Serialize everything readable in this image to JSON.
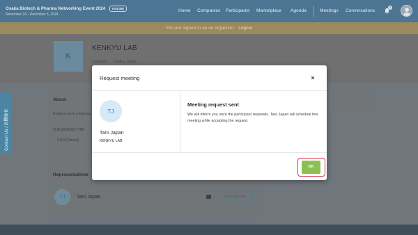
{
  "header": {
    "event_title": "Osaka Biotech & Pharma Networking Event 2024",
    "event_badge": "ONLINE",
    "event_dates": "November 24 - December 6, 2024",
    "nav": [
      "Home",
      "Companies",
      "Participants",
      "Marketplace",
      "Agenda",
      "Meetings",
      "Conversations"
    ],
    "notification_count": "1"
  },
  "banner": {
    "text": "You are signed in as an organizer.",
    "logout": "Logout"
  },
  "company": {
    "logo_letter": "K",
    "name": "KENKYU LAB",
    "type": "Company",
    "location": "Osaka, Japan"
  },
  "contact_tab": "Contact Us / お問合せ",
  "about": {
    "heading": "About",
    "text": "Kenkyu Lab is a fictional",
    "business_type_label": "2) BUSINESS TYPE",
    "business_type_value": "CRO (Clinical)"
  },
  "representatives": {
    "heading": "Representatives",
    "avatar_initials": "TJ",
    "name": "Taro Japan",
    "view_meeting": "View meeting"
  },
  "modal": {
    "title": "Request meeting",
    "close_glyph": "×",
    "avatar_initials": "TJ",
    "person_name": "Taro Japan",
    "person_company": "KENKYU LAB",
    "sent_title": "Meeting request sent",
    "sent_message": "We will inform you once the participant responds. Taro Japan will schedule this meeting while accepting the request.",
    "ok_label": "OK"
  },
  "colors": {
    "accent_ok": "#8cc152",
    "highlight": "#d9364c",
    "avatar_bg": "#d5eaf6"
  },
  "icons": {
    "bell": "bell-icon",
    "chat": "chat-icon",
    "close": "close-icon"
  }
}
